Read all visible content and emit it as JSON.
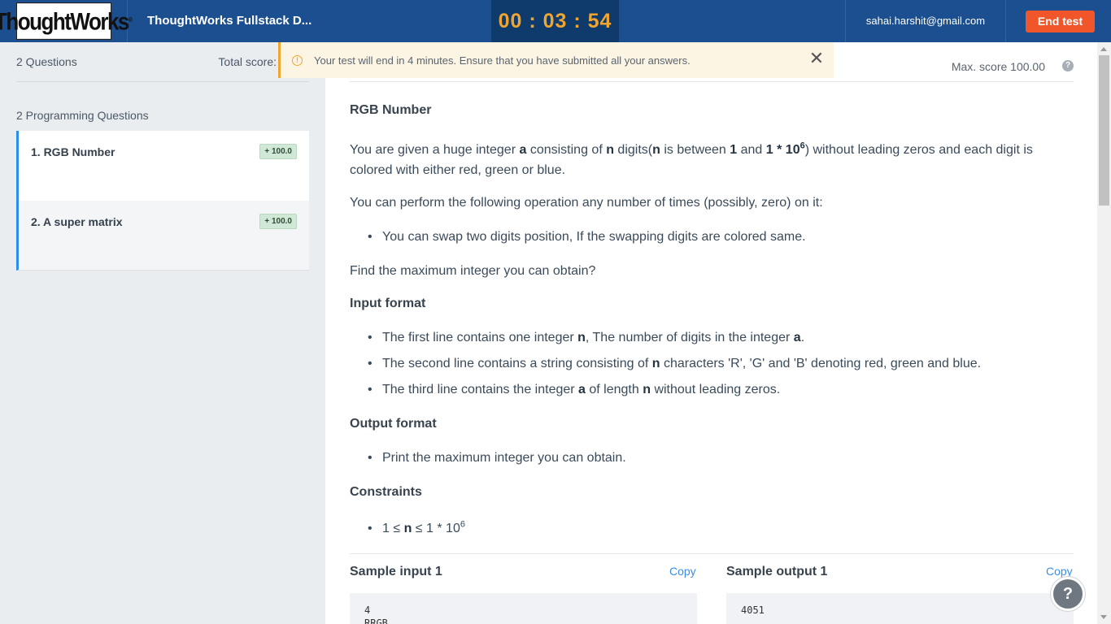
{
  "header": {
    "logo_text": "ThoughtWorks",
    "test_title": "ThoughtWorks Fullstack D...",
    "timer": "00 : 03 : 54",
    "email": "sahai.harshit@gmail.com",
    "end_test_label": "End test"
  },
  "sidebar": {
    "question_count": "2 Questions",
    "total_score_label": "Total score:",
    "section_title": "2 Programming Questions",
    "items": [
      {
        "label": "1. RGB Number",
        "score": "+ 100.0"
      },
      {
        "label": "2. A super matrix",
        "score": "+ 100.0"
      }
    ]
  },
  "notice": {
    "text": "Your test will end in 4 minutes. Ensure that you have submitted all your answers."
  },
  "main": {
    "max_score": "Max. score 100.00",
    "question_title": "RGB Number",
    "intro": {
      "p1": "You are given a huge integer ",
      "a": "a",
      "p2": " consisting of ",
      "n": "n",
      "p3": " digits(",
      "n2": "n",
      "p4": " is between ",
      "one": "1",
      "p5": " and ",
      "upper": "1 * 10",
      "exp": "6",
      "p6": ") without leading zeros and each digit is colored with either red, green or blue."
    },
    "operation_text": "You can perform the following operation any number of times (possibly, zero) on it:",
    "operation_bullet": "You can swap two digits position, If the swapping digits are colored same.",
    "find_text": "Find the maximum integer you can obtain?",
    "input_format_title": "Input format",
    "input_b1": {
      "t1": "The first line contains one integer ",
      "n": "n",
      "t2": ", The number of digits in the integer ",
      "a": "a",
      "t3": "."
    },
    "input_b2": {
      "t1": "The second line contains a string consisting of ",
      "n": "n",
      "t2": " characters 'R', 'G' and 'B' denoting red, green and blue."
    },
    "input_b3": {
      "t1": "The third line contains the integer ",
      "a": "a",
      "t2": " of length ",
      "n": "n",
      "t3": " without leading zeros."
    },
    "output_format_title": "Output format",
    "output_bullet": "Print the maximum integer you can obtain.",
    "constraints_title": "Constraints",
    "constraint": {
      "t1": "1 ≤ ",
      "n": "n",
      "t2": " ≤ 1 * 10",
      "exp": "6"
    },
    "sample_input_title": "Sample input 1",
    "sample_output_title": "Sample output 1",
    "copy_label": "Copy",
    "sample_input_line1": "4",
    "sample_input_line2": "RRGB",
    "sample_output": "4051"
  }
}
